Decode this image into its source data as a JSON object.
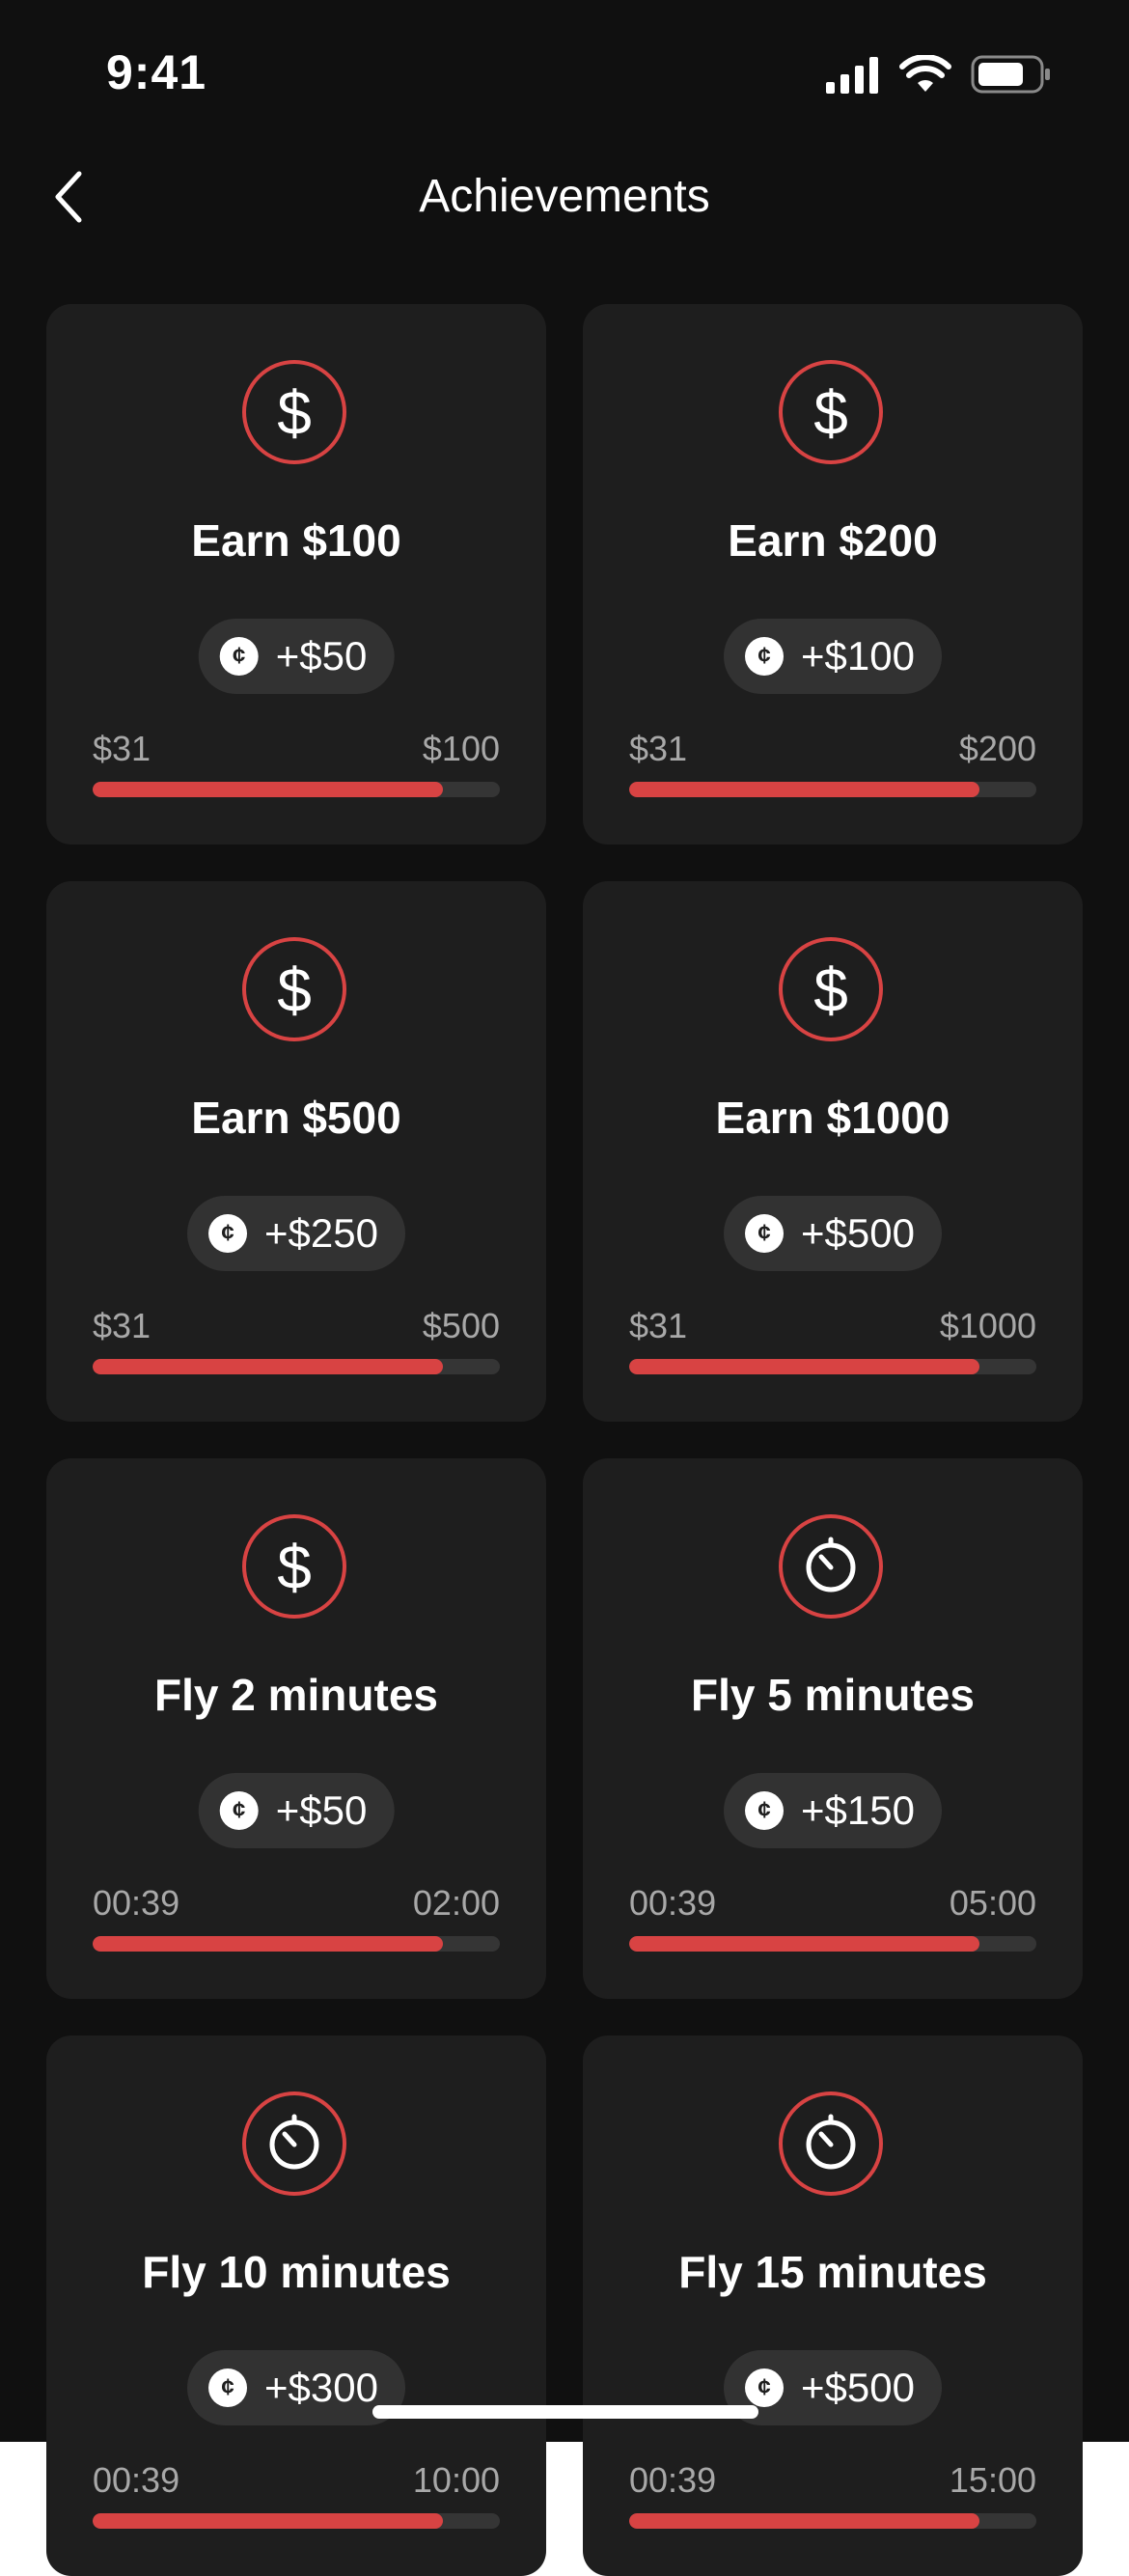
{
  "status_bar": {
    "time": "9:41"
  },
  "nav": {
    "title": "Achievements"
  },
  "colors": {
    "accent": "#d84343",
    "background": "#101010",
    "card": "#1e1e1e",
    "pill": "#323232"
  },
  "achievements": [
    {
      "title": "Earn $100",
      "icon": "dollar-icon",
      "reward": "+$50",
      "start": "$31",
      "end": "$100",
      "progress": 0.86
    },
    {
      "title": "Earn $200",
      "icon": "dollar-icon",
      "reward": "+$100",
      "start": "$31",
      "end": "$200",
      "progress": 0.86
    },
    {
      "title": "Earn $500",
      "icon": "dollar-icon",
      "reward": "+$250",
      "start": "$31",
      "end": "$500",
      "progress": 0.86
    },
    {
      "title": "Earn $1000",
      "icon": "dollar-icon",
      "reward": "+$500",
      "start": "$31",
      "end": "$1000",
      "progress": 0.86
    },
    {
      "title": "Fly 2 minutes",
      "icon": "dollar-icon",
      "reward": "+$50",
      "start": "00:39",
      "end": "02:00",
      "progress": 0.86
    },
    {
      "title": "Fly 5 minutes",
      "icon": "timer-icon",
      "reward": "+$150",
      "start": "00:39",
      "end": "05:00",
      "progress": 0.86
    },
    {
      "title": "Fly 10 minutes",
      "icon": "timer-icon",
      "reward": "+$300",
      "start": "00:39",
      "end": "10:00",
      "progress": 0.86
    },
    {
      "title": "Fly 15 minutes",
      "icon": "timer-icon",
      "reward": "+$500",
      "start": "00:39",
      "end": "15:00",
      "progress": 0.86
    }
  ]
}
